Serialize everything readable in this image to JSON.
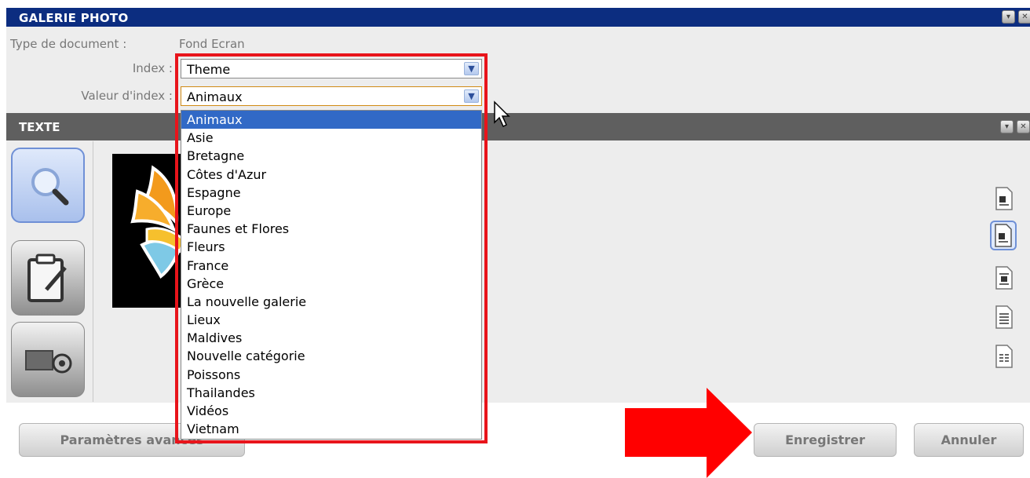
{
  "window": {
    "title": "GALERIE PHOTO",
    "minimize_glyph": "▾",
    "close_glyph": "✕"
  },
  "document": {
    "type_label": "Type de document :",
    "type_value": "Fond Ecran",
    "index_label": "Index :",
    "index_value": "Theme",
    "index_value_label": "Valeur d'index :",
    "index_value_value": "Animaux"
  },
  "section": {
    "title": "TEXTE"
  },
  "dropdown": {
    "selected": "Animaux",
    "options": [
      "Animaux",
      "Asie",
      "Bretagne",
      "Côtes d'Azur",
      "Espagne",
      "Europe",
      "Faunes et Flores",
      "Fleurs",
      "France",
      "Grèce",
      "La nouvelle galerie",
      "Lieux",
      "Maldives",
      "Nouvelle catégorie",
      "Poissons",
      "Thailandes",
      "Vidéos",
      "Vietnam"
    ]
  },
  "sidebar": {
    "tools": [
      "search-icon",
      "clipboard-edit-icon",
      "image-settings-icon"
    ]
  },
  "align_icons": [
    "align-left-icon",
    "align-right-icon",
    "align-center-icon",
    "align-justify-icon",
    "align-columns-icon"
  ],
  "footer": {
    "advanced_label": "Paramètres avancés",
    "save_label": "Enregistrer",
    "cancel_label": "Annuler"
  },
  "colors": {
    "title_bar": "#0c2d80",
    "section_bar": "#5f5f5f",
    "highlight_outline": "#e8141b",
    "selection": "#3169c6",
    "annotation_arrow": "#ff0000"
  }
}
